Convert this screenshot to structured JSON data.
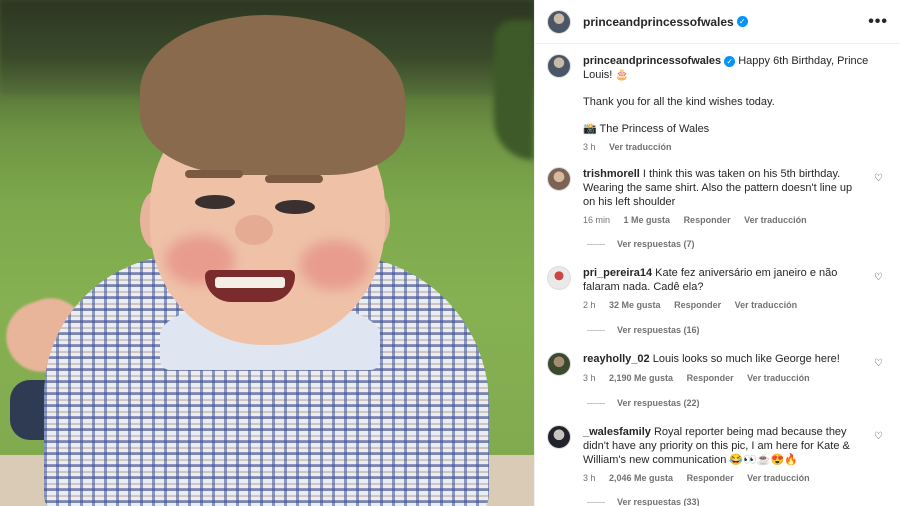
{
  "post": {
    "username": "princeandprincessofwales",
    "verified_mark": "✓",
    "menu_icon": "•••"
  },
  "caption": {
    "username": "princeandprincessofwales",
    "text": "Happy 6th Birthday, Prince Louis! 🎂",
    "line2": "Thank you for all the kind wishes today.",
    "credit": "📸 The Princess of Wales",
    "time": "3 h",
    "translate": "Ver traducción"
  },
  "comments": [
    {
      "username": "trishmorell",
      "text": "I think this was taken on his 5th birthday. Wearing the same shirt. Also the pattern doesn't line up on his left shoulder",
      "time": "16 min",
      "likes": "1 Me gusta",
      "reply": "Responder",
      "translate": "Ver traducción",
      "view_replies": "Ver respuestas (7)"
    },
    {
      "username": "pri_pereira14",
      "text": "Kate fez aniversário em janeiro e não falaram nada. Cadê ela?",
      "time": "2 h",
      "likes": "32 Me gusta",
      "reply": "Responder",
      "translate": "Ver traducción",
      "view_replies": "Ver respuestas (16)"
    },
    {
      "username": "reayholly_02",
      "text": "Louis looks so much like George here!",
      "time": "3 h",
      "likes": "2,190 Me gusta",
      "reply": "Responder",
      "translate": "Ver traducción",
      "view_replies": "Ver respuestas (22)"
    },
    {
      "username": "_walesfamily",
      "text": "Royal reporter being mad because they didn't have any priority on this pic, I am here for Kate & William's new communication 😂👀☕😍🔥",
      "time": "3 h",
      "likes": "2,046 Me gusta",
      "reply": "Responder",
      "translate": "Ver traducción",
      "view_replies": "Ver respuestas (33)"
    }
  ],
  "icons": {
    "heart": "♡"
  }
}
